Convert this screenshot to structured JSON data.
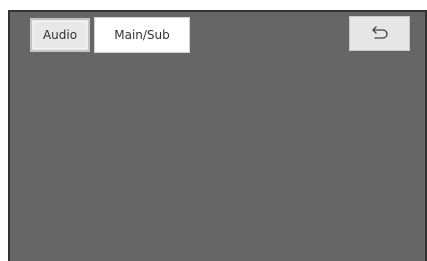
{
  "tabs": {
    "audio_label": "Audio",
    "main_sub_label": "Main/Sub"
  },
  "toolbar": {
    "back_icon": "back-arrow-icon"
  },
  "colors": {
    "screen_background": "#666666",
    "active_tab": "#ffffff",
    "inactive_tab": "#e8e8e8",
    "back_button": "#e6e6e6"
  }
}
